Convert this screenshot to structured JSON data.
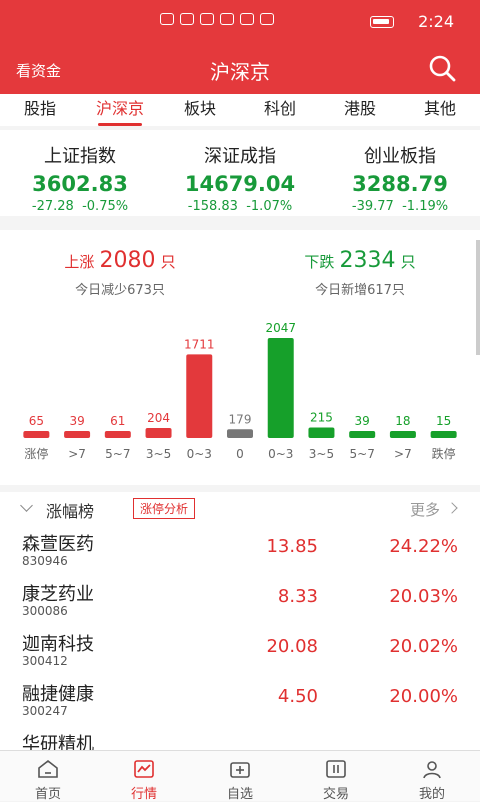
{
  "status": {
    "time": "2:24"
  },
  "header": {
    "left_label": "看资金",
    "title": "沪深京"
  },
  "tabs": [
    {
      "label": "股指"
    },
    {
      "label": "沪深京"
    },
    {
      "label": "板块"
    },
    {
      "label": "科创"
    },
    {
      "label": "港股"
    },
    {
      "label": "其他"
    }
  ],
  "active_tab": 1,
  "indices": [
    {
      "name": "上证指数",
      "value": "3602.83",
      "change": "-27.28",
      "pct": "-0.75%"
    },
    {
      "name": "深证成指",
      "value": "14679.04",
      "change": "-158.83",
      "pct": "-1.07%"
    },
    {
      "name": "创业板指",
      "value": "3288.79",
      "change": "-39.77",
      "pct": "-1.19%"
    }
  ],
  "summary": {
    "up_label": "上涨",
    "up_count": "2080",
    "unit": "只",
    "up_sub": "今日减少673只",
    "down_label": "下跌",
    "down_count": "2334",
    "down_sub": "今日新增617只"
  },
  "chart_data": {
    "type": "bar",
    "categories": [
      "涨停",
      ">7",
      "5~7",
      "3~5",
      "0~3",
      "0",
      "0~3",
      "3~5",
      "5~7",
      ">7",
      "跌停"
    ],
    "values": [
      65,
      39,
      61,
      204,
      1711,
      179,
      2047,
      215,
      39,
      18,
      15
    ],
    "colors": [
      "#e3393c",
      "#e3393c",
      "#e3393c",
      "#e3393c",
      "#e3393c",
      "#777777",
      "#16a02a",
      "#16a02a",
      "#16a02a",
      "#16a02a",
      "#16a02a"
    ],
    "title": "",
    "xlabel": "",
    "ylabel": ""
  },
  "ranking": {
    "title": "涨幅榜",
    "tag": "涨停分析",
    "more": "更多",
    "rows": [
      {
        "name": "森萱医药",
        "code": "830946",
        "price": "13.85",
        "pct": "24.22%"
      },
      {
        "name": "康芝药业",
        "code": "300086",
        "price": "8.33",
        "pct": "20.03%"
      },
      {
        "name": "迦南科技",
        "code": "300412",
        "price": "20.08",
        "pct": "20.02%"
      },
      {
        "name": "融捷健康",
        "code": "300247",
        "price": "4.50",
        "pct": "20.00%"
      },
      {
        "name": "华研精机",
        "code": "",
        "price": "",
        "pct": ""
      }
    ]
  },
  "nav": [
    {
      "label": "首页",
      "icon": "home-icon"
    },
    {
      "label": "行情",
      "icon": "market-icon"
    },
    {
      "label": "自选",
      "icon": "watchlist-icon"
    },
    {
      "label": "交易",
      "icon": "trade-icon"
    },
    {
      "label": "我的",
      "icon": "profile-icon"
    }
  ],
  "active_nav": 1
}
